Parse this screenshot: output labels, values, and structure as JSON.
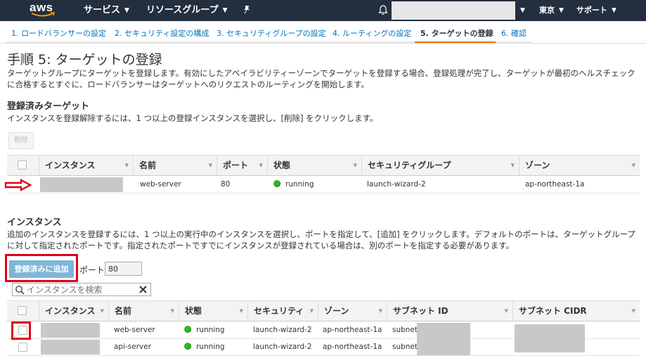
{
  "nav": {
    "logo": "aws",
    "services": "サービス",
    "resource_groups": "リソースグループ",
    "region": "東京",
    "support": "サポート",
    "icons": [
      "pin-icon",
      "bell-icon"
    ]
  },
  "steps": [
    {
      "label": "1. ロードバランサーの設定"
    },
    {
      "label": "2. セキュリティ設定の構成"
    },
    {
      "label": "3. セキュリティグループの設定"
    },
    {
      "label": "4. ルーティングの設定"
    },
    {
      "label": "5. ターゲットの登録",
      "active": true
    },
    {
      "label": "6. 確認"
    }
  ],
  "page": {
    "title": "手順 5: ターゲットの登録",
    "intro": "ターゲットグループにターゲットを登録します。有効にしたアベイラビリティーゾーンでターゲットを登録する場合、登録処理が完了し、ターゲットが最初のヘルスチェックに合格するとすぐに、ロードバランサーはターゲットへのリクエストのルーティングを開始します。"
  },
  "registered": {
    "heading": "登録済みターゲット",
    "description": "インスタンスを登録解除するには、1 つ以上の登録インスタンスを選択し、[削除] をクリックします。",
    "remove_button": "削除",
    "columns": [
      "インスタンス",
      "名前",
      "ポート",
      "状態",
      "セキュリティグループ",
      "ゾーン"
    ],
    "rows": [
      {
        "instance": "",
        "name": "web-server",
        "port": "80",
        "state": "running",
        "security_group": "launch-wizard-2",
        "zone": "ap-northeast-1a"
      }
    ]
  },
  "instances": {
    "heading": "インスタンス",
    "description": "追加のインスタンスを登録するには、1 つ以上の実行中のインスタンスを選択し、ポートを指定して、[追加] をクリックします。デフォルトのポートは、ターゲットグループに対して指定されたポートです。指定されたポートですでにインスタンスが登録されている場合は、別のポートを指定する必要があります。",
    "add_button": "登録済みに追加",
    "port_label": "ポート",
    "port_value": "80",
    "search_placeholder": "インスタンスを検索",
    "columns": [
      "インスタンス",
      "名前",
      "状態",
      "セキュリティ",
      "ゾーン",
      "サブネット ID",
      "サブネット CIDR"
    ],
    "rows": [
      {
        "instance": "",
        "name": "web-server",
        "state": "running",
        "security": "launch-wizard-2",
        "zone": "ap-northeast-1a",
        "subnet_id": "subnet-",
        "subnet_cidr": ""
      },
      {
        "instance": "",
        "name": "api-server",
        "state": "running",
        "security": "launch-wizard-2",
        "zone": "ap-northeast-1a",
        "subnet_id": "subnet-",
        "subnet_cidr": ""
      }
    ]
  },
  "colors": {
    "nav_bg": "#232f3e",
    "link": "#0073bb",
    "active_step": "#ec7211",
    "running": "#2fb52a",
    "annotation": "#e0001a",
    "add_button": "#7db6d8"
  }
}
